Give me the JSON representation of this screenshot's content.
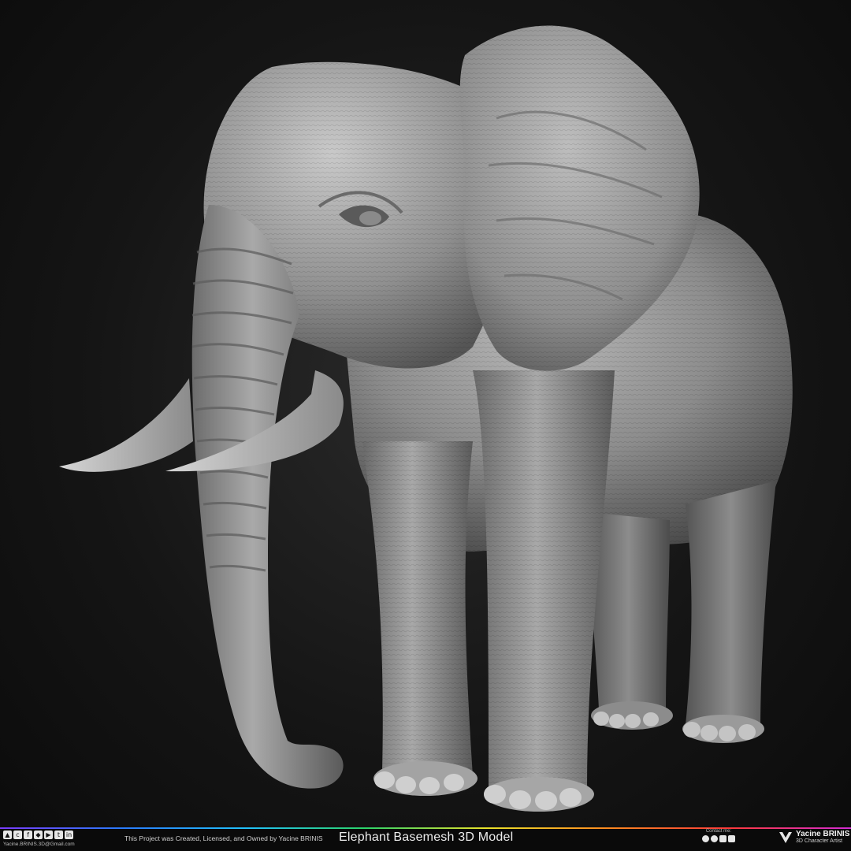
{
  "artwork": {
    "subject": "elephant-sculpt"
  },
  "footer": {
    "credit": "This Project was Created, Licensed, and Owned by Yacine BRINIS",
    "title": "Elephant Basemesh 3D Model",
    "email": "Yacine.BRINIS.3D@Gmail.com",
    "contact_label": "Contact me:",
    "brand_name": "Yacine BRINIS",
    "brand_role": "3D Character Artist",
    "social_icons": [
      "artstation-icon",
      "cgtrader-icon",
      "facebook-icon",
      "sketchfab-icon",
      "youtube-icon",
      "twitter-icon",
      "linkedin-icon"
    ],
    "contact_icons": [
      "facebook-icon",
      "twitter-icon",
      "instagram-icon",
      "youtube-icon"
    ]
  },
  "colors": {
    "background": "#151515",
    "sculpt": "#8a8a8a",
    "footer": "#0a0a0a"
  }
}
